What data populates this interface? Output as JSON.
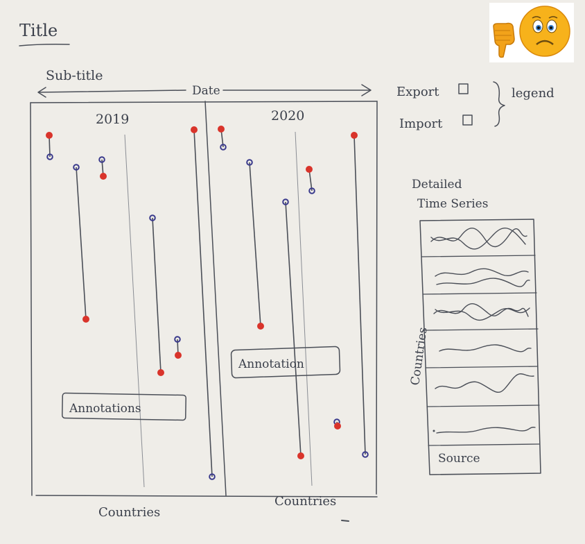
{
  "title": "Title",
  "subtitle": "Sub-title",
  "top_axis_label": "Date",
  "legend": {
    "items": [
      "Export",
      "Import"
    ],
    "label": "legend"
  },
  "panels": [
    {
      "label": "2019",
      "xlabel": "Countries",
      "annotation": "Annotations"
    },
    {
      "label": "2020",
      "xlabel": "Countries",
      "annotation": "Annotation"
    }
  ],
  "side_panel": {
    "title_line1": "Detailed",
    "title_line2": "Time Series",
    "ylabel": "Countries",
    "source": "Source"
  },
  "colors": {
    "export_dot": "#d9342b",
    "import_dot": "#3a3a8c",
    "ink": "#4a4e57",
    "paper": "#efede8",
    "emoji_face": "#f7b21b"
  },
  "icons": [
    "thumbs-down-icon",
    "sad-face-icon"
  ]
}
